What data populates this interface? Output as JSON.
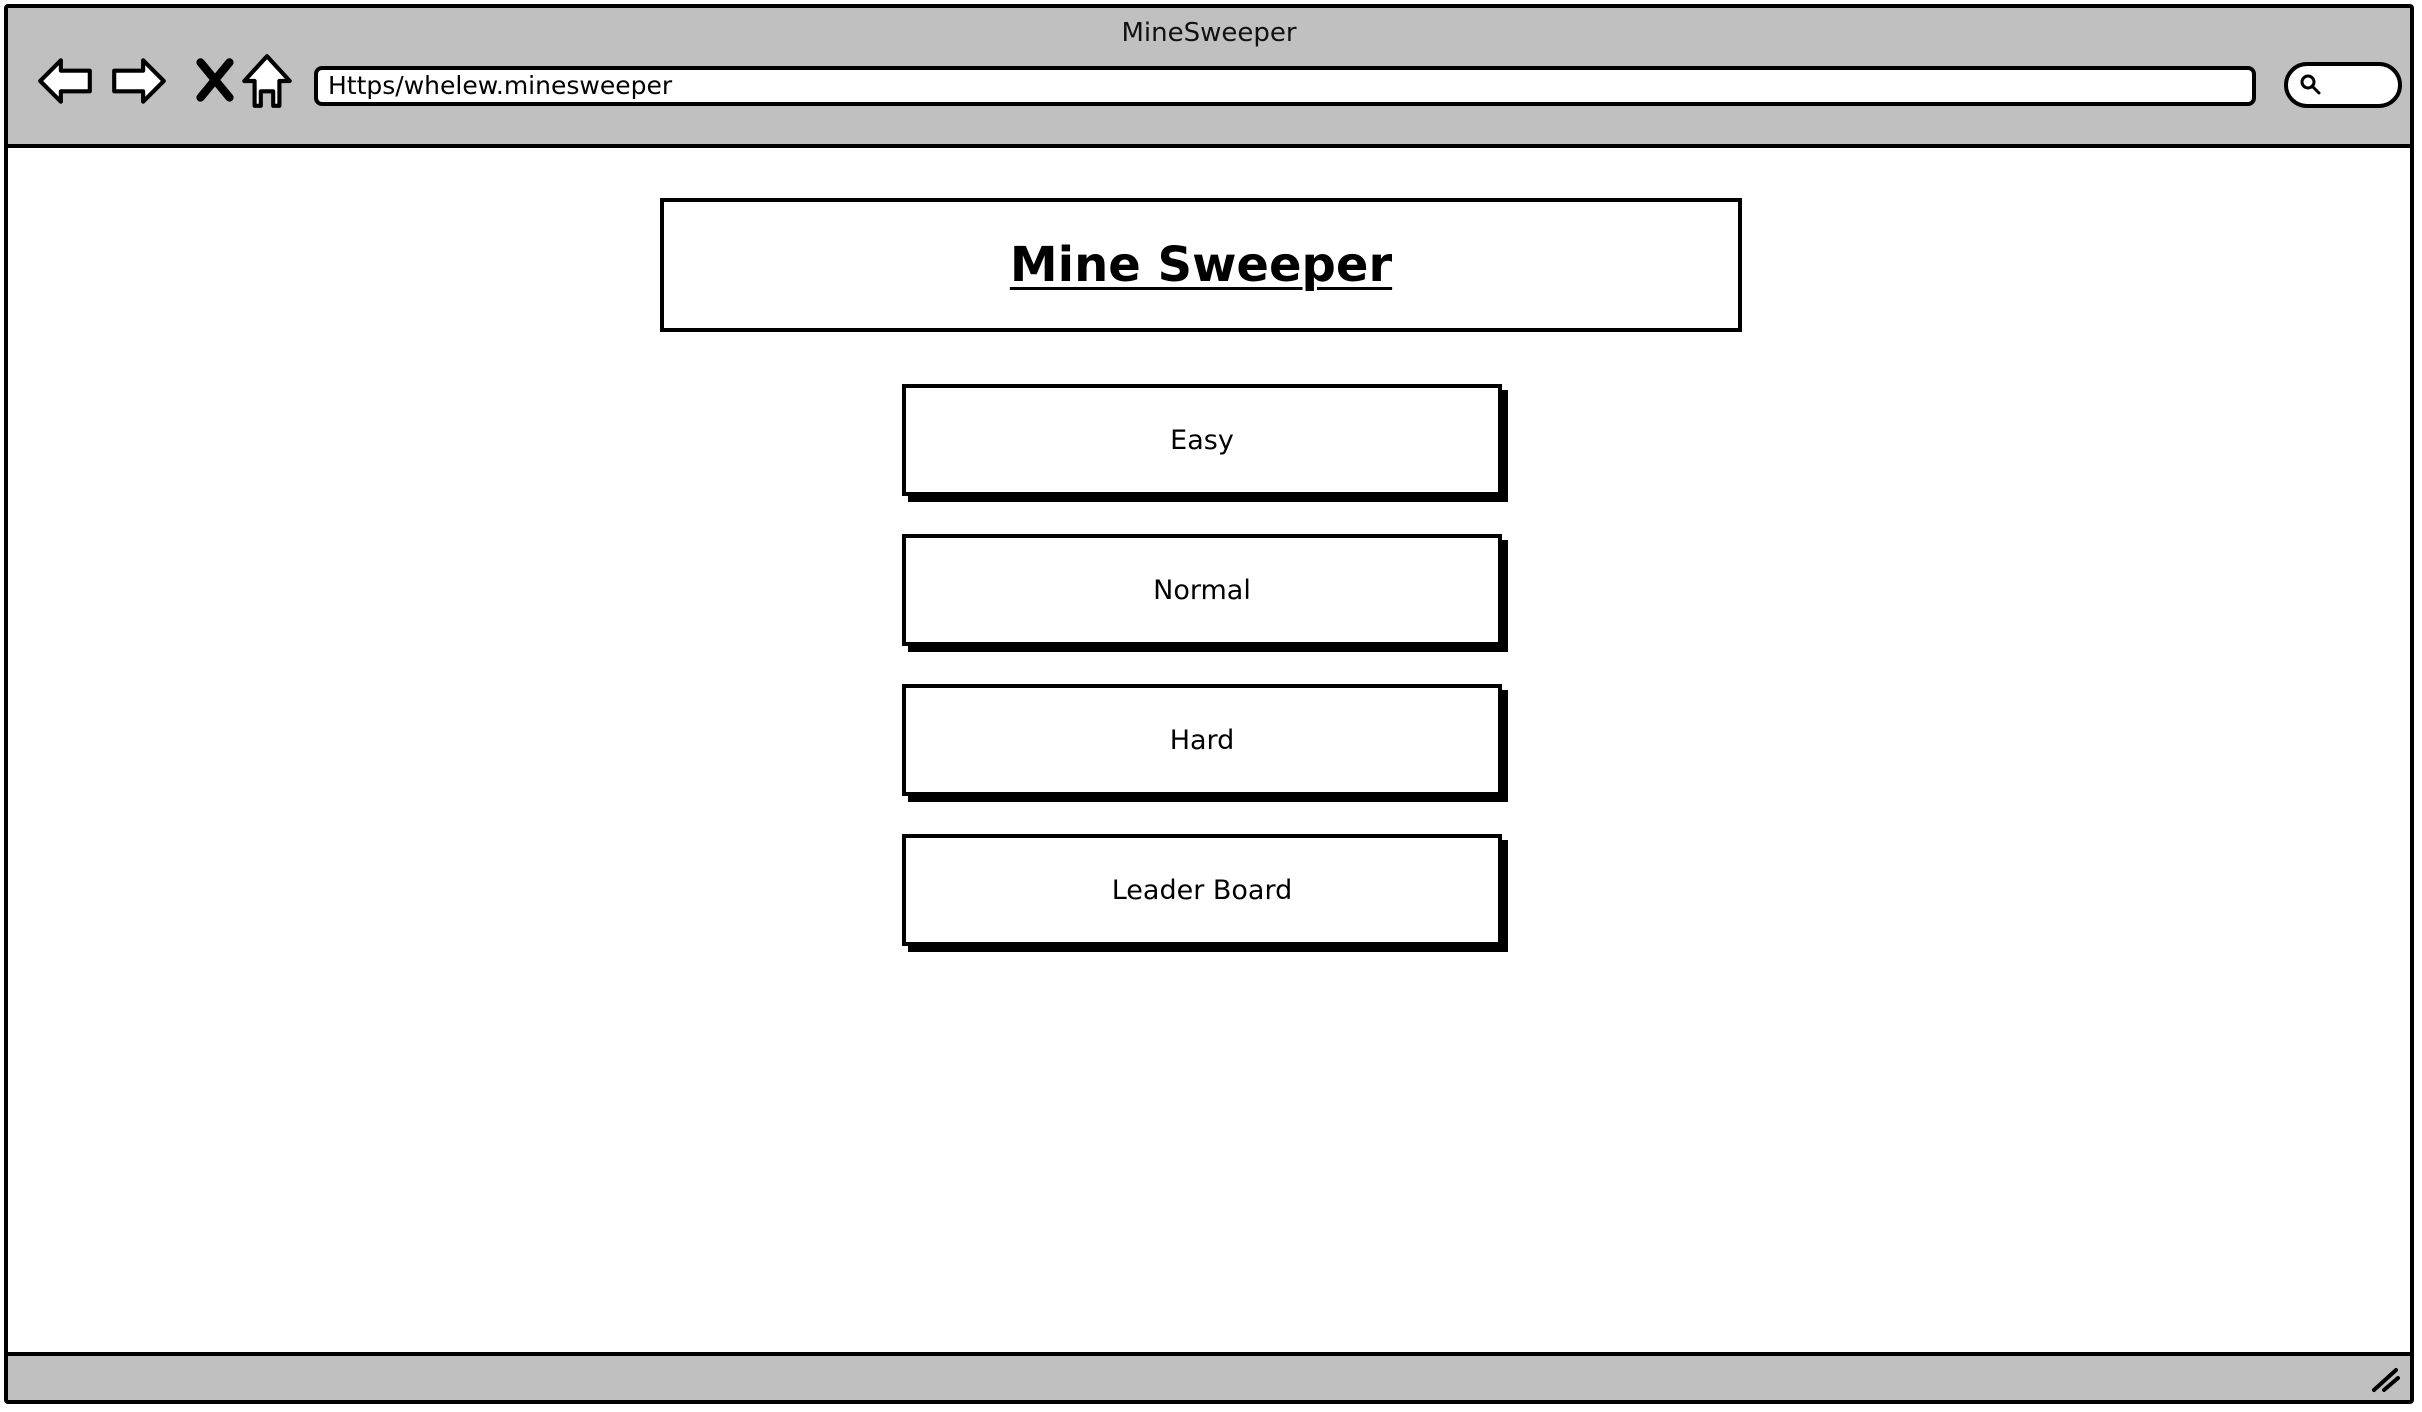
{
  "window": {
    "title": "MineSweeper"
  },
  "toolbar": {
    "back_icon": "back-arrow-icon",
    "forward_icon": "forward-arrow-icon",
    "stop_icon": "close-icon",
    "home_icon": "home-icon",
    "address": "Https/whelew.minesweeper",
    "search_icon": "search-icon"
  },
  "main": {
    "title": "Mine Sweeper",
    "buttons": [
      {
        "label": "Easy"
      },
      {
        "label": "Normal"
      },
      {
        "label": "Hard"
      },
      {
        "label": "Leader Board"
      }
    ]
  },
  "colors": {
    "chrome": "#c0c0c0",
    "border": "#000000",
    "background": "#ffffff"
  }
}
